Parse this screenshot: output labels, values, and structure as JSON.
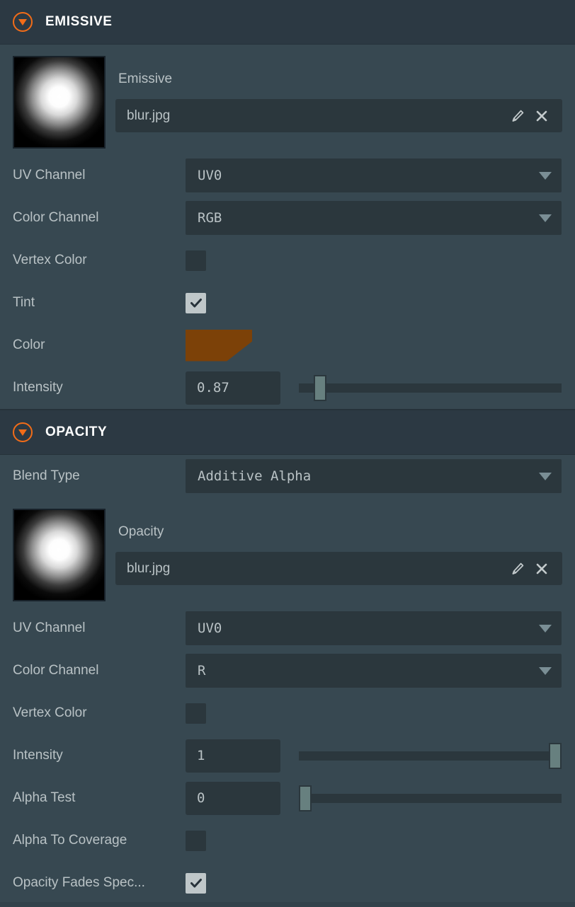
{
  "sections": [
    {
      "id": "emissive",
      "title": "EMISSIVE",
      "collapse_icon": "chevron-down-circle-icon",
      "accent_color": "#F26C18",
      "texture": {
        "label": "Emissive",
        "file_name": "blur.jpg",
        "edit_icon": "pencil-icon",
        "clear_icon": "close-icon",
        "thumbnail": "radial-blur-white-on-black"
      },
      "rows": [
        {
          "type": "dropdown",
          "label": "UV Channel",
          "value": "UV0",
          "caret_icon": "chevron-down-icon"
        },
        {
          "type": "dropdown",
          "label": "Color Channel",
          "value": "RGB",
          "caret_icon": "chevron-down-icon"
        },
        {
          "type": "checkbox",
          "label": "Vertex Color",
          "checked": false
        },
        {
          "type": "checkbox",
          "label": "Tint",
          "checked": true
        },
        {
          "type": "color",
          "label": "Color",
          "value": "#7C4108"
        },
        {
          "type": "slider",
          "label": "Intensity",
          "value": "0.87",
          "percent": 6,
          "min": 0,
          "max": 15
        }
      ]
    },
    {
      "id": "opacity",
      "title": "OPACITY",
      "collapse_icon": "chevron-down-circle-icon",
      "accent_color": "#F26C18",
      "pre_rows": [
        {
          "type": "dropdown",
          "label": "Blend Type",
          "value": "Additive Alpha",
          "caret_icon": "chevron-down-icon"
        }
      ],
      "texture": {
        "label": "Opacity",
        "file_name": "blur.jpg",
        "edit_icon": "pencil-icon",
        "clear_icon": "close-icon",
        "thumbnail": "radial-blur-white-on-black"
      },
      "rows": [
        {
          "type": "dropdown",
          "label": "UV Channel",
          "value": "UV0",
          "caret_icon": "chevron-down-icon"
        },
        {
          "type": "dropdown",
          "label": "Color Channel",
          "value": "R",
          "caret_icon": "chevron-down-icon"
        },
        {
          "type": "checkbox",
          "label": "Vertex Color",
          "checked": false
        },
        {
          "type": "slider",
          "label": "Intensity",
          "value": "1",
          "percent": 100,
          "min": 0,
          "max": 1
        },
        {
          "type": "slider",
          "label": "Alpha Test",
          "value": "0",
          "percent": 0,
          "min": 0,
          "max": 1
        },
        {
          "type": "checkbox",
          "label": "Alpha To Coverage",
          "checked": false
        },
        {
          "type": "checkbox",
          "label": "Opacity Fades Spec...",
          "checked": true
        }
      ]
    }
  ],
  "theme": {
    "panel_background": "#374851",
    "header_background": "#2C3943",
    "field_background": "#2B373D",
    "text_color": "#B9C2C5",
    "title_color": "#FFFFFF",
    "accent": "#F26C18",
    "slider_thumb": "#67807F",
    "checkbox_checked": "#BFC7C9"
  }
}
